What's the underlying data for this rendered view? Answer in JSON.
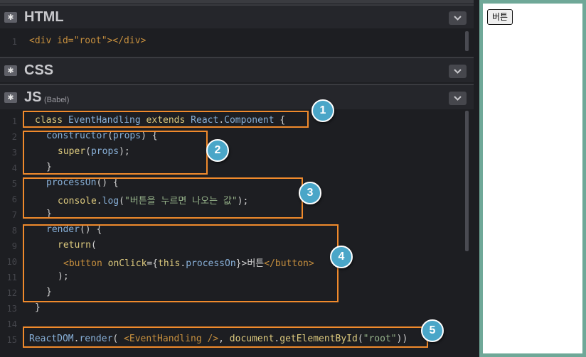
{
  "panels": {
    "html": {
      "title": "HTML",
      "code": "<div id=\"root\"></div>",
      "line": "1"
    },
    "css": {
      "title": "CSS"
    },
    "js": {
      "title": "JS",
      "subtitle": "(Babel)"
    }
  },
  "js_code": {
    "line_numbers": [
      "1",
      "2",
      "3",
      "4",
      "5",
      "6",
      "7",
      "8",
      "9",
      "10",
      "11",
      "12",
      "13",
      "14",
      "15"
    ],
    "l1": [
      "class ",
      "EventHandling",
      " ",
      "extends",
      " ",
      "React",
      ".",
      "Component",
      " {"
    ],
    "l2": [
      "constructor",
      "(",
      "props",
      ") {"
    ],
    "l3": [
      "super",
      "(",
      "props",
      ");"
    ],
    "l4": "}",
    "l5": [
      "processOn",
      "() {"
    ],
    "l6": [
      "console",
      ".",
      "log",
      "(",
      "\"버튼을 누르면 나오는 값\"",
      ");"
    ],
    "l7": "}",
    "l8": [
      "render",
      "() {"
    ],
    "l9": [
      "return",
      "("
    ],
    "l10": [
      "<button",
      " ",
      "onClick",
      "={",
      "this",
      ".",
      "processOn",
      "}>",
      "버튼",
      "</button>"
    ],
    "l11": ");",
    "l12": "}",
    "l13": "}",
    "l15": [
      "ReactDOM",
      ".",
      "render",
      "( ",
      "<EventHandling />",
      ", ",
      "document",
      ".",
      "getElementById",
      "(",
      "\"root\"",
      "))"
    ]
  },
  "badges": [
    "1",
    "2",
    "3",
    "4",
    "5"
  ],
  "preview": {
    "button_label": "버튼"
  },
  "colors": {
    "highlight_box": "#f08a2c",
    "badge": "#4aa6c8",
    "preview_border": "#6fa898"
  }
}
